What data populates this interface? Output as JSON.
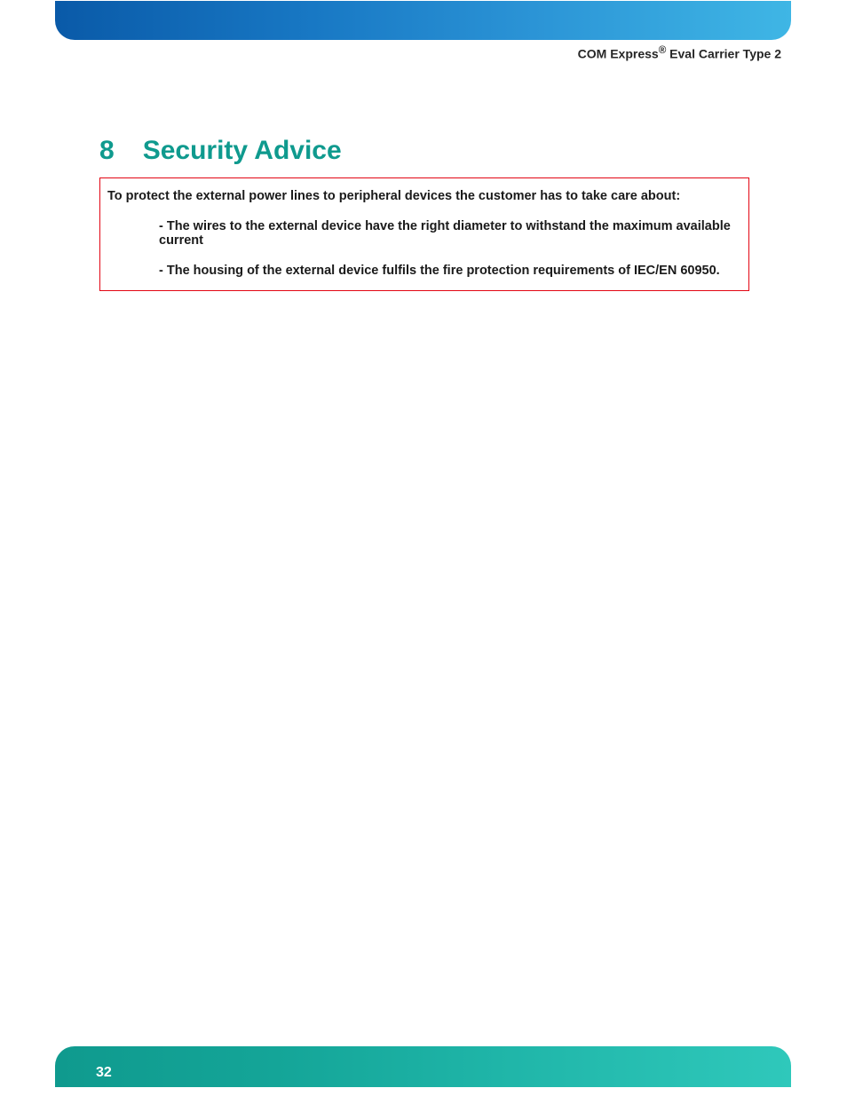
{
  "header": {
    "product_line": "COM Express",
    "product_suffix": " Eval Carrier Type 2"
  },
  "section": {
    "number": "8",
    "title": "Security Advice"
  },
  "advice": {
    "intro": "To protect the external power lines to peripheral devices the customer has to take care about:",
    "items": [
      "- The wires to the external device have the right diameter to withstand the maximum available current",
      "- The housing of the external device fulfils the fire protection requirements of IEC/EN 60950."
    ]
  },
  "footer": {
    "page_number": "32"
  }
}
